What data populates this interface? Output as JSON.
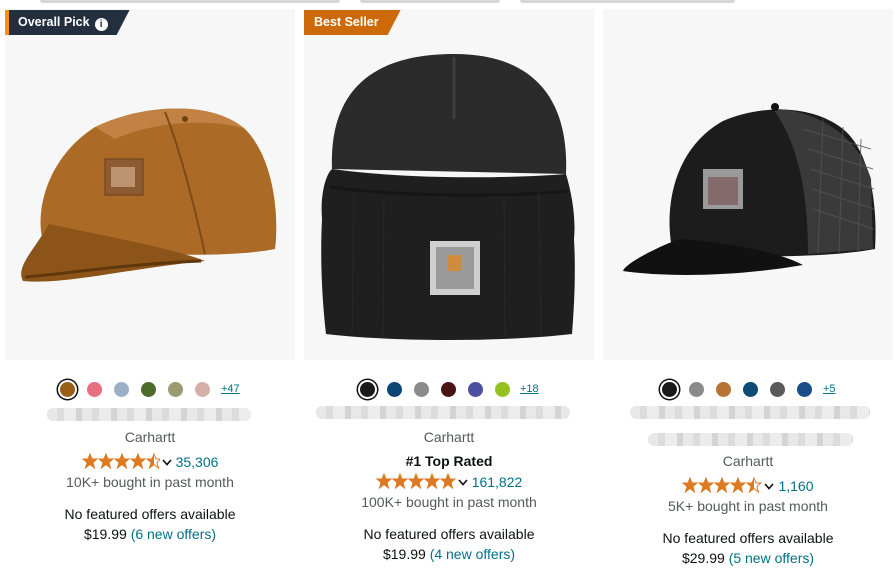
{
  "products": [
    {
      "badge": "Overall Pick",
      "badge_color": "#232f3e",
      "image_icon": "brown-canvas-cap-image",
      "swatches": [
        "#9a5f16",
        "#e86f80",
        "#9ab0c4",
        "#4e6b2c",
        "#9c9a72",
        "#d4b0a6"
      ],
      "more_colors": "+47",
      "brand": "Carhartt",
      "rating": 4.5,
      "review_count": "35,306",
      "bought": "10K+ bought in past month",
      "no_featured": "No featured offers available",
      "price": "$19.99",
      "offers": "(6 new offers)"
    },
    {
      "badge": "Best Seller",
      "badge_color": "#cc6a0a",
      "image_icon": "black-beanie-image",
      "swatches": [
        "#1a1a1a",
        "#0e4577",
        "#8a8a8a",
        "#4a1414",
        "#4d4fa3",
        "#94c11e"
      ],
      "more_colors": "+18",
      "brand": "Carhartt",
      "top_rated": "#1 Top Rated",
      "rating": 4.8,
      "review_count": "161,822",
      "bought": "100K+ bought in past month",
      "no_featured": "No featured offers available",
      "price": "$19.99",
      "offers": "(4 new offers)"
    },
    {
      "badge": "",
      "image_icon": "black-trucker-cap-image",
      "swatches": [
        "#1a1a1a",
        "#8a8a8a",
        "#b87333",
        "#0e4a74",
        "#5a5a5a",
        "#1a4e8a"
      ],
      "more_colors": "+5",
      "brand": "Carhartt",
      "rating": 4.5,
      "review_count": "1,160",
      "bought": "5K+ bought in past month",
      "no_featured": "No featured offers available",
      "price": "$29.99",
      "offers": "(5 new offers)"
    }
  ],
  "colors": {
    "star": "#de7921",
    "link": "#007185"
  }
}
